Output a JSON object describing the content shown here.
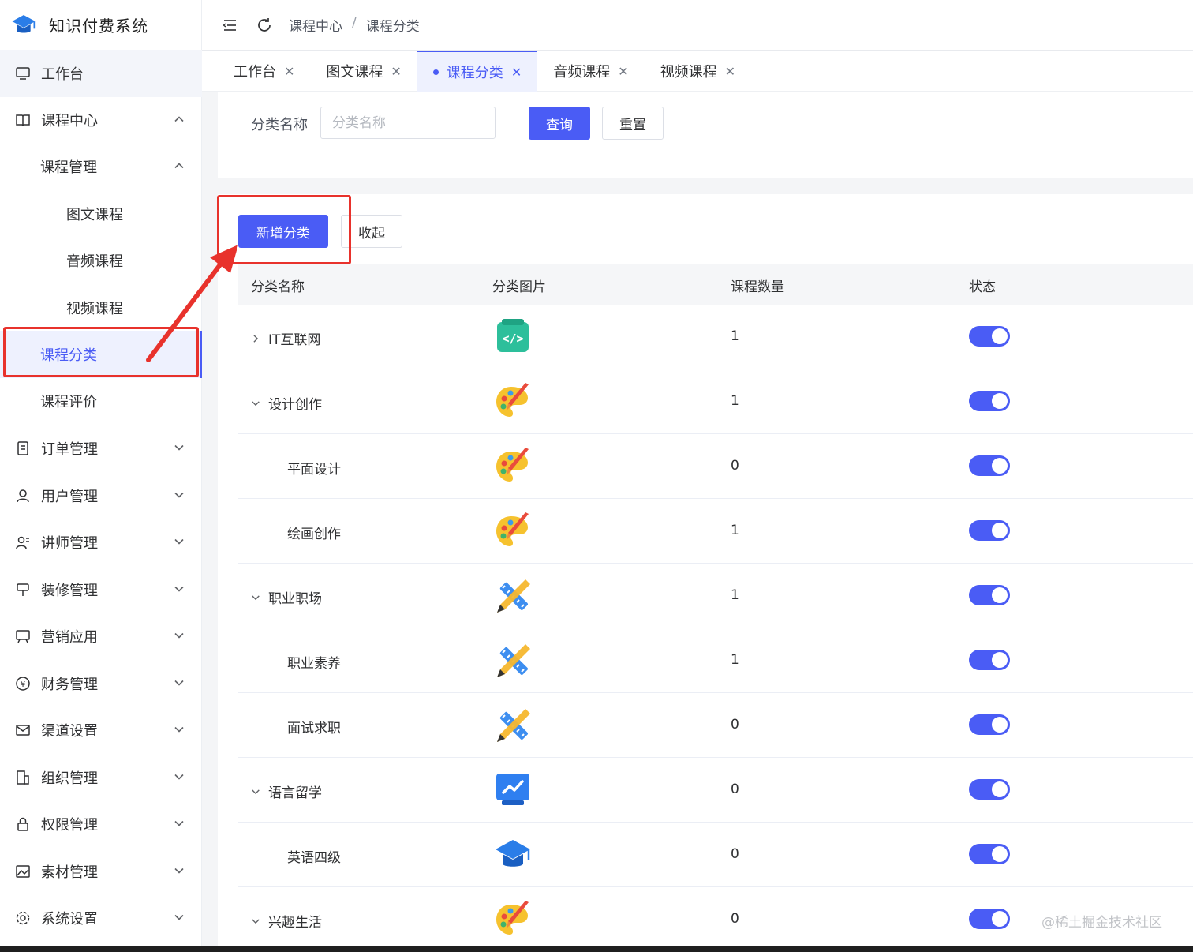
{
  "app": {
    "title": "知识付费系统"
  },
  "sidebar": {
    "workbench": "工作台",
    "course_center": "课程中心",
    "course_manage": "课程管理",
    "sub_items": [
      "图文课程",
      "音频课程",
      "视频课程"
    ],
    "course_category": "课程分类",
    "course_review": "课程评价",
    "groups": [
      "订单管理",
      "用户管理",
      "讲师管理",
      "装修管理",
      "营销应用",
      "财务管理",
      "渠道设置",
      "组织管理",
      "权限管理",
      "素材管理",
      "系统设置"
    ]
  },
  "header": {
    "breadcrumb": [
      "课程中心",
      "课程分类"
    ],
    "separator": "/"
  },
  "tabs": [
    "工作台",
    "图文课程",
    "课程分类",
    "音频课程",
    "视频课程"
  ],
  "tab_close": "✕",
  "search": {
    "label": "分类名称",
    "placeholder": "分类名称",
    "query_label": "查询",
    "reset_label": "重置"
  },
  "toolbar": {
    "add_label": "新增分类",
    "collapse_label": "收起"
  },
  "table": {
    "headers": [
      "分类名称",
      "分类图片",
      "课程数量",
      "状态"
    ],
    "rows": [
      {
        "name": "IT互联网",
        "count": "1",
        "icon": "code-icon",
        "expand": "collapsed",
        "level": 0,
        "enabled": true
      },
      {
        "name": "设计创作",
        "count": "1",
        "icon": "palette-icon",
        "expand": "expanded",
        "level": 0,
        "enabled": true
      },
      {
        "name": "平面设计",
        "count": "0",
        "icon": "palette-icon",
        "expand": "none",
        "level": 1,
        "enabled": true
      },
      {
        "name": "绘画创作",
        "count": "1",
        "icon": "palette-icon",
        "expand": "none",
        "level": 1,
        "enabled": true
      },
      {
        "name": "职业职场",
        "count": "1",
        "icon": "ruler-pencil-icon",
        "expand": "expanded",
        "level": 0,
        "enabled": true
      },
      {
        "name": "职业素养",
        "count": "1",
        "icon": "ruler-pencil-icon",
        "expand": "none",
        "level": 1,
        "enabled": true
      },
      {
        "name": "面试求职",
        "count": "0",
        "icon": "ruler-pencil-icon",
        "expand": "none",
        "level": 1,
        "enabled": true
      },
      {
        "name": "语言留学",
        "count": "0",
        "icon": "chart-board-icon",
        "expand": "expanded",
        "level": 0,
        "enabled": true
      },
      {
        "name": "英语四级",
        "count": "0",
        "icon": "graduation-cap-icon",
        "expand": "none",
        "level": 1,
        "enabled": true
      },
      {
        "name": "兴趣生活",
        "count": "0",
        "icon": "palette-icon",
        "expand": "expanded",
        "level": 0,
        "enabled": true
      }
    ]
  },
  "watermark": "@稀土掘金技术社区",
  "colors": {
    "primary": "#4a5cf5",
    "annotation": "#e8322c"
  }
}
